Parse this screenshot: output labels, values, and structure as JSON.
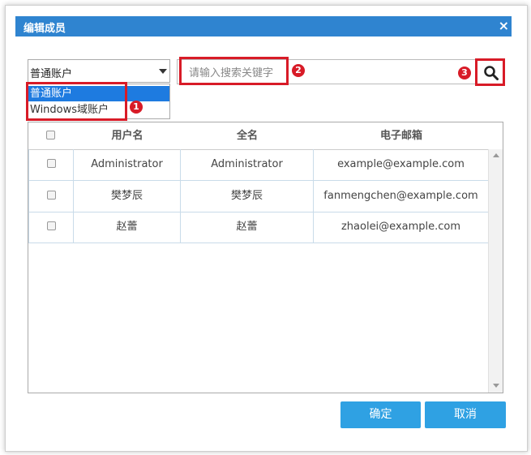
{
  "dialog": {
    "title": "编辑成员",
    "close_glyph": "✕"
  },
  "account_type": {
    "selected": "普通账户",
    "options": [
      "普通账户",
      "Windows域账户"
    ]
  },
  "search": {
    "placeholder": "请输入搜索关键字",
    "icon": "search-icon"
  },
  "annotations": [
    "1",
    "2",
    "3"
  ],
  "table": {
    "columns": [
      "",
      "用户名",
      "全名",
      "电子邮箱"
    ],
    "rows": [
      {
        "username": "Administrator",
        "fullname": "Administrator",
        "email": "example@example.com"
      },
      {
        "username": "樊梦辰",
        "fullname": "樊梦辰",
        "email": "fanmengchen@example.com"
      },
      {
        "username": "赵蕾",
        "fullname": "赵蕾",
        "email": "zhaolei@example.com"
      }
    ]
  },
  "footer": {
    "confirm_label": "确定",
    "cancel_label": "取消"
  },
  "colors": {
    "titlebar": "#2f84d0",
    "highlight": "#d81b27",
    "button": "#2fa1e3",
    "selected_option": "#1e7be0"
  }
}
